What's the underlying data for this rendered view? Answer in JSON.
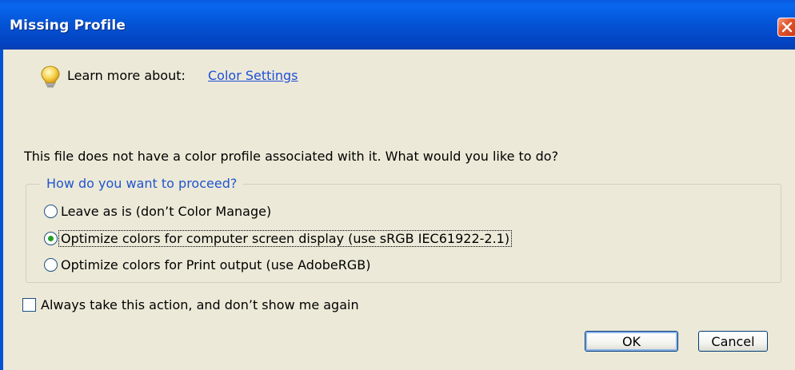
{
  "window": {
    "title": "Missing Profile"
  },
  "help": {
    "prefix": "Learn more about:",
    "link": "Color Settings"
  },
  "question": "This file does not have a color profile associated with it. What would you like to do?",
  "group": {
    "legend": "How do you want to proceed?",
    "options": [
      {
        "label": "Leave as is (don’t Color Manage)",
        "selected": false
      },
      {
        "label": "Optimize colors for computer screen display (use sRGB IEC61922-2.1)",
        "selected": true
      },
      {
        "label": "Optimize colors for Print output (use AdobeRGB)",
        "selected": false
      }
    ]
  },
  "always": {
    "label": "Always take this action, and don’t show me again",
    "checked": false
  },
  "buttons": {
    "ok": "OK",
    "cancel": "Cancel"
  },
  "icons": {
    "close": "close-icon",
    "tip": "lightbulb-icon"
  },
  "colors": {
    "titlebar": "#0453d4",
    "link": "#1f4fd8",
    "legend": "#1f55cf",
    "radio_dot": "#21a121"
  }
}
